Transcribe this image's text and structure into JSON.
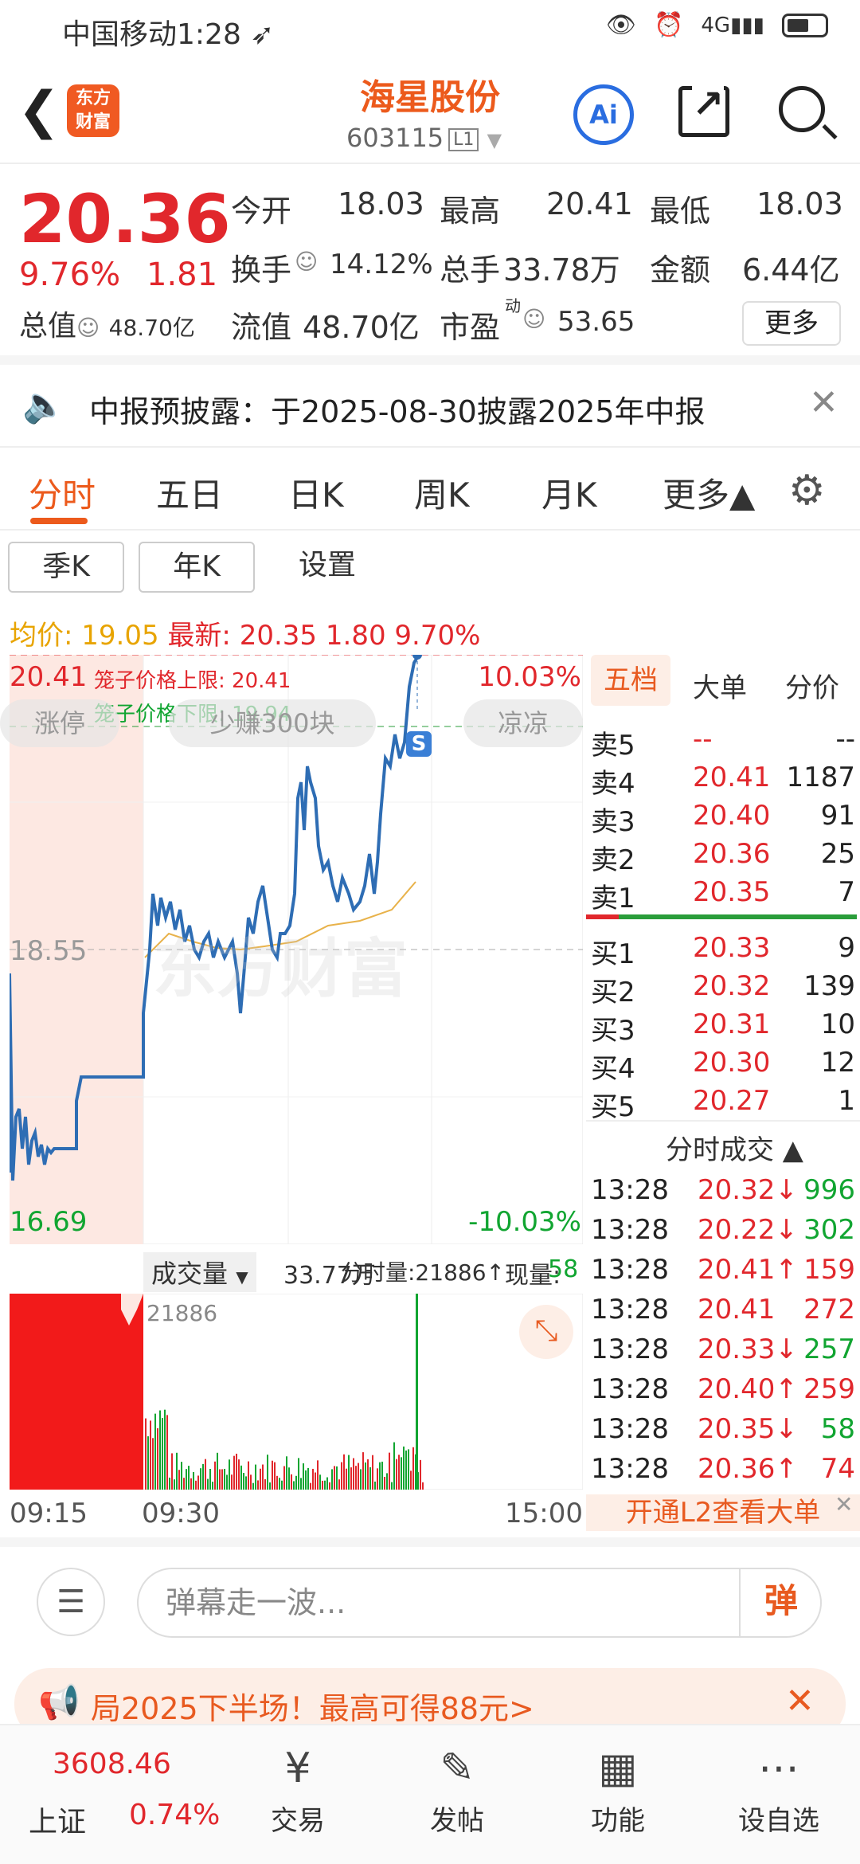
{
  "status": {
    "carrier": "中国移动",
    "time": "1:28"
  },
  "header": {
    "name": "海星股份",
    "code": "603115",
    "level": "L1",
    "logo": "东方\n财富",
    "ai": "Ai"
  },
  "quote": {
    "price": "20.36",
    "pct": "9.76%",
    "change": "1.81",
    "total_value_label": "总值",
    "total_value": "48.70亿",
    "open_label": "今开",
    "open": "18.03",
    "high_label": "最高",
    "high": "20.41",
    "low_label": "最低",
    "low": "18.03",
    "turnover_label": "换手",
    "turnover": "14.12%",
    "volume_label": "总手",
    "volume": "33.78万",
    "amount_label": "金额",
    "amount": "6.44亿",
    "float_label": "流值",
    "float_value": "48.70亿",
    "pe_label": "市盈",
    "pe_sup": "动",
    "pe": "53.65",
    "more": "更多"
  },
  "notice": {
    "text": "中报预披露：于2025-08-30披露2025年中报"
  },
  "tabs": [
    "分时",
    "五日",
    "日K",
    "周K",
    "月K",
    "更多▲"
  ],
  "subtabs": [
    "季K",
    "年K",
    "设置"
  ],
  "avg": {
    "avg_label": "均价:",
    "avg": "19.05",
    "latest_label": "最新:",
    "latest": "20.35",
    "chg": "1.80",
    "pct": "9.70%"
  },
  "chart": {
    "upper_price": "20.41",
    "mid_price": "18.55",
    "lower_price": "16.69",
    "upper_pct": "10.03%",
    "lower_pct": "-10.03%",
    "cage_upper": "笼子价格上限: 20.41",
    "cage_lower": "笼子价格下限: 19.94",
    "bubble_left": "涨停",
    "bubble_mid": "少赚300块",
    "bubble_right": "凉凉",
    "s_badge": "S",
    "watermark": "东方财富"
  },
  "volbar": {
    "label": "成交量",
    "total": "33.77万",
    "fs_label": "分时量:21886↑",
    "now_label": "现量:",
    "now": "58"
  },
  "vol_max": "21886",
  "time_axis": [
    "09:15",
    "09:30",
    "15:00"
  ],
  "orderbook": {
    "tabs": [
      "五档",
      "大单",
      "分价"
    ],
    "asks": [
      {
        "label": "卖5",
        "price": "--",
        "vol": "--"
      },
      {
        "label": "卖4",
        "price": "20.41",
        "vol": "1187"
      },
      {
        "label": "卖3",
        "price": "20.40",
        "vol": "91"
      },
      {
        "label": "卖2",
        "price": "20.36",
        "vol": "25"
      },
      {
        "label": "卖1",
        "price": "20.35",
        "vol": "7"
      }
    ],
    "bids": [
      {
        "label": "买1",
        "price": "20.33",
        "vol": "9"
      },
      {
        "label": "买2",
        "price": "20.32",
        "vol": "139"
      },
      {
        "label": "买3",
        "price": "20.31",
        "vol": "10"
      },
      {
        "label": "买4",
        "price": "20.30",
        "vol": "12"
      },
      {
        "label": "买5",
        "price": "20.27",
        "vol": "1"
      }
    ],
    "trades_title": "分时成交 ▲",
    "trades": [
      {
        "time": "13:28",
        "price": "20.32↓",
        "vol": "996",
        "dir": "down"
      },
      {
        "time": "13:28",
        "price": "20.22↓",
        "vol": "302",
        "dir": "down"
      },
      {
        "time": "13:28",
        "price": "20.41↑",
        "vol": "159",
        "dir": "up"
      },
      {
        "time": "13:28",
        "price": "20.41",
        "vol": "272",
        "dir": "up"
      },
      {
        "time": "13:28",
        "price": "20.33↓",
        "vol": "257",
        "dir": "down"
      },
      {
        "time": "13:28",
        "price": "20.40↑",
        "vol": "259",
        "dir": "up"
      },
      {
        "time": "13:28",
        "price": "20.35↓",
        "vol": "58",
        "dir": "down"
      },
      {
        "time": "13:28",
        "price": "20.36↑",
        "vol": "74",
        "dir": "up"
      }
    ],
    "l2": "开通L2查看大单"
  },
  "danmu": {
    "placeholder": "弹幕走一波...",
    "send": "弹"
  },
  "promo": {
    "text": "局2025下半场！最高可得88元>"
  },
  "bottom": {
    "index_value": "3608.46",
    "index_name": "上证",
    "index_pct": "0.74%",
    "items": [
      "交易",
      "发帖",
      "功能",
      "设自选"
    ]
  }
}
